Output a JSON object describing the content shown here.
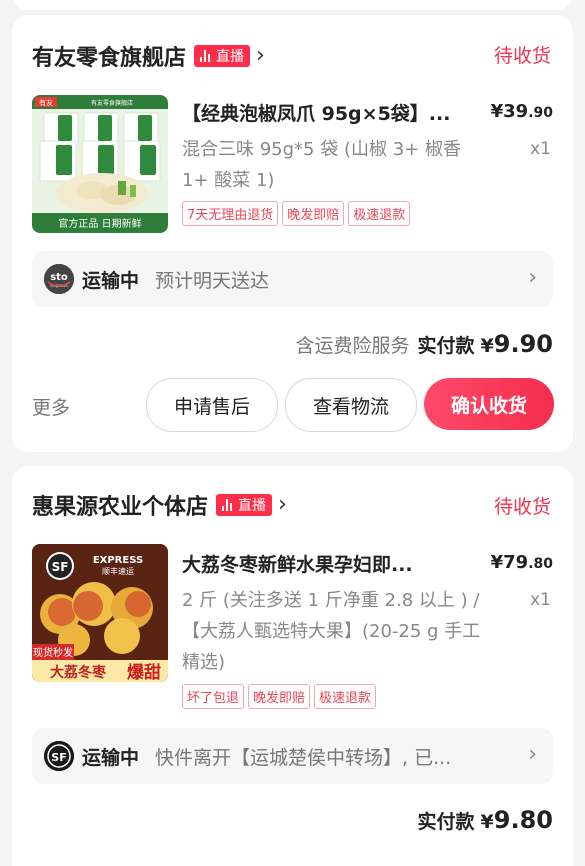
{
  "orders": [
    {
      "shop_name": "有友零食旗舰店",
      "live_label": "直播",
      "status": "待收货",
      "product_image": {
        "brand": "有友",
        "store": "有友零食旗舰店",
        "pack_text": "泡椒凤爪",
        "banner": "官方正品 日期新鲜"
      },
      "title": "【经典泡椒凤爪 95g×5袋】...",
      "price_int": "¥39",
      "price_dec": ".90",
      "spec": "混合三味 95g*5 袋 (山椒 3+ 椒香 1+ 酸菜 1)",
      "qty": "x1",
      "tags": [
        "7天无理由退货",
        "晚发即赔",
        "极速退款"
      ],
      "logistics": {
        "carrier": "sto",
        "carrier_sub": "express",
        "status": "运输中",
        "desc": "预计明天送达"
      },
      "pay_note": "含运费险服务",
      "pay_label": "实付款",
      "pay_currency": "¥",
      "pay_amount": "9.90",
      "more": "更多",
      "buttons": [
        "申请售后",
        "查看物流",
        "确认收货"
      ]
    },
    {
      "shop_name": "惠果源农业个体店",
      "live_label": "直播",
      "status": "待收货",
      "product_image": {
        "express_label": "EXPRESS",
        "express_cn": "顺丰速运",
        "banner1": "现货秒发",
        "banner2": "大荔冬枣",
        "banner3": "爆甜"
      },
      "title": "大荔冬枣新鲜水果孕妇即...",
      "price_int": "¥79",
      "price_dec": ".80",
      "spec": "2 斤 (关注多送 1 斤净重 2.8 以上 ) /【大荔人甄选特大果】(20-25 g 手工精选)",
      "qty": "x1",
      "tags": [
        "坏了包退",
        "晚发即赔",
        "极速退款"
      ],
      "logistics": {
        "carrier": "SF",
        "status": "运输中",
        "desc": "快件离开【运城楚侯中转场】, 已..."
      },
      "pay_label": "实付款",
      "pay_currency": "¥",
      "pay_amount": "9.80"
    }
  ],
  "colors": {
    "accent": "#f0344f",
    "live_badge": "#ff2d4a",
    "tag_text": "#e8465c",
    "background": "#f4f4f4"
  }
}
